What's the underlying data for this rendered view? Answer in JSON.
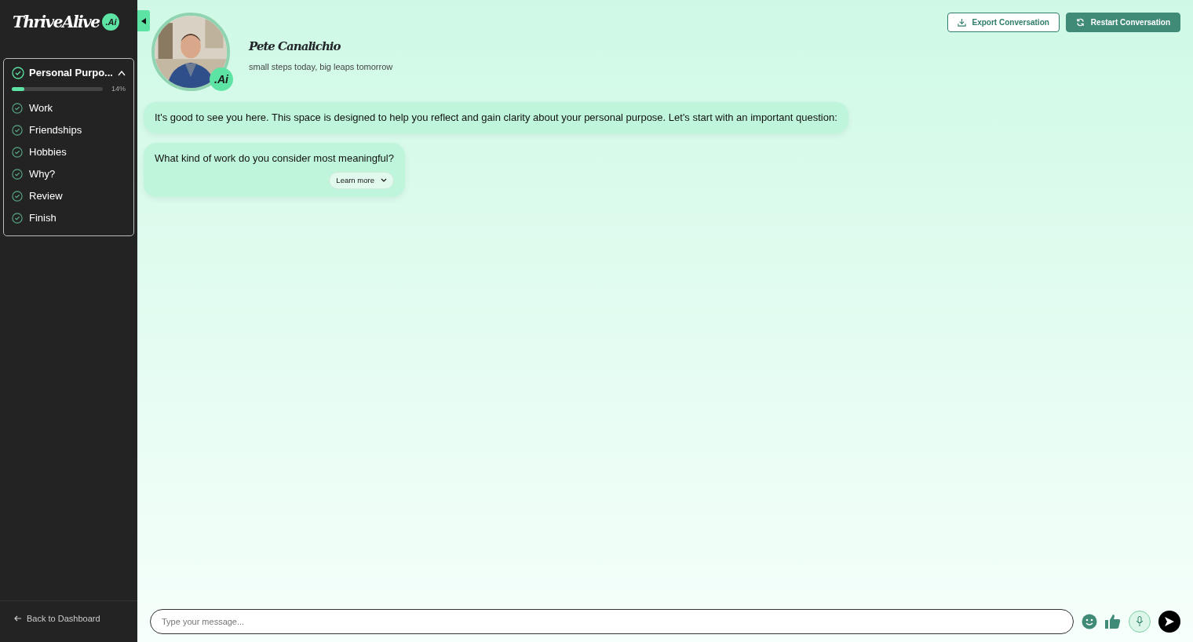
{
  "logo": {
    "text": "ThriveAlive",
    "badge": ".Ai"
  },
  "module": {
    "title": "Personal Purpo...",
    "expanded": true,
    "level": 0.14,
    "reading": "14%",
    "steps": [
      {
        "label": "Work"
      },
      {
        "label": "Friendships"
      },
      {
        "label": "Hobbies"
      },
      {
        "label": "Why?"
      },
      {
        "label": "Review"
      },
      {
        "label": "Finish"
      }
    ]
  },
  "back_link": "Back to Dashboard",
  "coach": {
    "name": "Pete Canalichio",
    "tagline": "small steps today, big leaps tomorrow",
    "badge": ".Ai"
  },
  "buttons": [
    {
      "kind": "export",
      "label": "Export Conversation"
    },
    {
      "kind": "restart",
      "label": "Restart Conversation"
    }
  ],
  "messages": [
    {
      "text": "It's good to see you here. This space is designed to help you reflect and gain clarity about your personal purpose. Let's start with an important question:"
    },
    {
      "text": "What kind of work do you consider most meaningful?",
      "action": "Learn more"
    }
  ],
  "composer": {
    "placeholder": "Type your message..."
  }
}
